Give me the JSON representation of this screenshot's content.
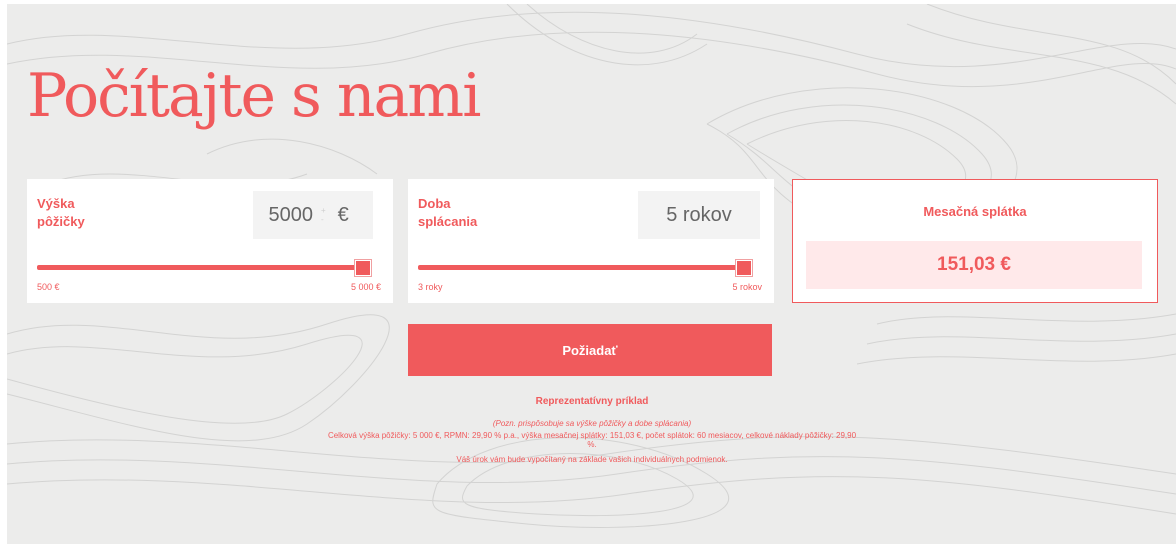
{
  "page": {
    "title": "Počítajte s nami"
  },
  "amount_card": {
    "label": "Výška pôžičky",
    "value": "5000",
    "currency": "€",
    "slider_fraction": 1.0,
    "min_label": "500 €",
    "max_label": "5 000 €"
  },
  "term_card": {
    "label": "Doba splácania",
    "value": "5 rokov",
    "slider_fraction": 1.0,
    "min_label": "3 roky",
    "max_label": "5 rokov"
  },
  "result_card": {
    "label": "Mesačná splátka",
    "value": "151,03 €"
  },
  "apply_button": {
    "label": "Požiadať"
  },
  "representative_example": {
    "title": "Reprezentatívny príklad",
    "note": "(Pozn. prispôsobuje sa výške pôžičky a dobe splácania)",
    "details": "Celková výška pôžičky: 5 000 €, RPMN: 29,90 % p.a., výška mesačnej splátky: 151,03 €, počet splátok: 60 mesiacov, celkové náklady pôžičky: 29,90 %.",
    "disclaimer": "Váš úrok vám bude vypočítaný na základe vašich individuálnych podmienok."
  },
  "colors": {
    "accent": "#f05a5c",
    "background": "#ececeb",
    "result_bg": "#ffe9ea"
  }
}
